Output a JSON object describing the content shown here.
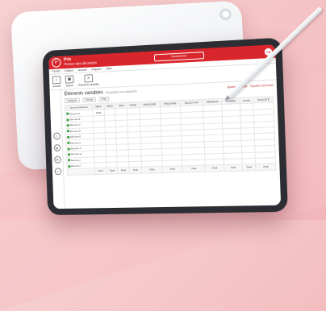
{
  "app": {
    "logo": "P",
    "name": "Prio",
    "subtitle": "Prenez des décisions",
    "search_placeholder": "Rechercher",
    "user_initials": "GB"
  },
  "menu": [
    "Fichier",
    "Éditeur",
    "Accueil",
    "Rapport",
    "Aide"
  ],
  "ribbon": [
    {
      "icon": "home-icon",
      "label": "Accueil"
    },
    {
      "icon": "save-icon",
      "label": "Sauver"
    },
    {
      "icon": "list-icon",
      "label": "Éléments variables"
    }
  ],
  "page": {
    "title": "Éléments variables",
    "subtitle": "Remplissez vos catégories",
    "links": [
      "Ajouter éléments",
      "Exporter vers excel"
    ]
  },
  "filters": [
    "Catégorie",
    "Période",
    "Filtre"
  ],
  "table": {
    "headers": [
      "Nom de l'élément",
      "SÉLÉ",
      "HÉLÉ",
      "TÉLÉ",
      "PREM",
      "PRÉLEVÉE",
      "PRELAVEE",
      "SELECTION",
      "RÉSERVÉ",
      "VENDRE",
      "vendre",
      "Stock ÉTÉ"
    ],
    "rows": [
      [
        "Elément A",
        "5000",
        "",
        "",
        "",
        "",
        "",
        "",
        "",
        "",
        "",
        ""
      ],
      [
        "Elément B",
        "",
        "",
        "",
        "",
        "",
        "",
        "",
        "",
        "",
        "",
        ""
      ],
      [
        "Elément C",
        "",
        "",
        "",
        "",
        "",
        "",
        "",
        "",
        "",
        "",
        ""
      ],
      [
        "Elément D",
        "",
        "",
        "",
        "",
        "",
        "",
        "",
        "",
        "",
        "",
        ""
      ],
      [
        "Elément E",
        "",
        "",
        "",
        "",
        "",
        "",
        "",
        "",
        "",
        "",
        ""
      ],
      [
        "Elément F",
        "",
        "",
        "",
        "",
        "",
        "",
        "",
        "",
        "",
        "",
        ""
      ],
      [
        "Elément G",
        "",
        "",
        "",
        "",
        "",
        "",
        "",
        "",
        "",
        "",
        ""
      ],
      [
        "Elément H",
        "",
        "",
        "",
        "",
        "",
        "",
        "",
        "",
        "",
        "",
        ""
      ],
      [
        "Elément I",
        "",
        "",
        "",
        "",
        "",
        "",
        "",
        "",
        "",
        "",
        ""
      ],
      [
        "Elément J",
        "",
        "",
        "",
        "",
        "",
        "",
        "",
        "",
        "",
        "",
        ""
      ]
    ],
    "footer": [
      "",
      "Total",
      "Total",
      "Total",
      "Total",
      "Total",
      "Total",
      "Total",
      "Total",
      "Total",
      "Total",
      "Total"
    ]
  },
  "nav_icons": [
    "home-icon",
    "chart-icon",
    "gear-icon",
    "user-icon"
  ],
  "colors": {
    "brand": "#d9262c",
    "status_green": "#3a9d3a",
    "background": "#f5c4c6"
  }
}
